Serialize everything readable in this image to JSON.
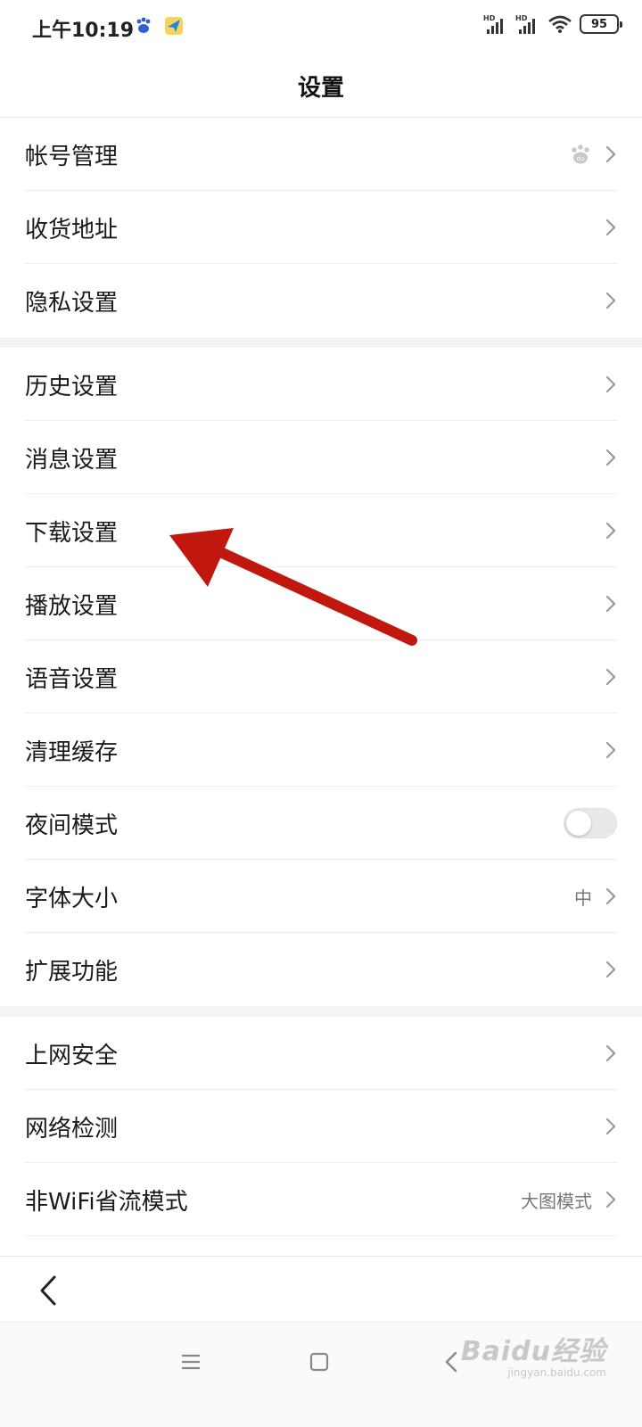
{
  "status_bar": {
    "time": "上午10:19",
    "battery": "95",
    "signal_label_1": "HD",
    "signal_label_2": "HD"
  },
  "header": {
    "title": "设置"
  },
  "groups": [
    {
      "items": [
        {
          "label": "帐号管理",
          "accessory": "baidu-paw-icon"
        },
        {
          "label": "收货地址"
        },
        {
          "label": "隐私设置"
        }
      ]
    },
    {
      "items": [
        {
          "label": "历史设置"
        },
        {
          "label": "消息设置"
        },
        {
          "label": "下载设置"
        },
        {
          "label": "播放设置"
        },
        {
          "label": "语音设置"
        },
        {
          "label": "清理缓存"
        },
        {
          "label": "夜间模式",
          "toggle": false
        },
        {
          "label": "字体大小",
          "value": "中"
        },
        {
          "label": "扩展功能"
        }
      ]
    },
    {
      "items": [
        {
          "label": "上网安全"
        },
        {
          "label": "网络检测"
        },
        {
          "label": "非WiFi省流模式",
          "value": "大图模式"
        }
      ]
    }
  ],
  "annotation": {
    "color": "#c0170f",
    "points_to": "下载设置"
  },
  "watermark": {
    "logo": "Baidu经验",
    "sub": "jingyan.baidu.com"
  },
  "colors": {
    "accent_arrow": "#c0170f",
    "chevron": "#9a9a9a",
    "divider": "#efefef",
    "group_gap": "#f4f4f4"
  }
}
